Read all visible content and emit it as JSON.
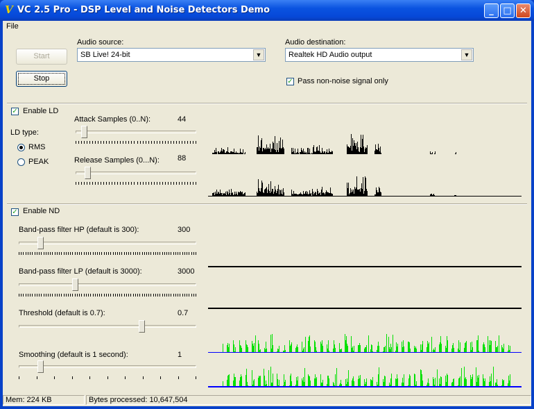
{
  "window": {
    "title": "VC 2.5 Pro - DSP Level and Noise Detectors Demo",
    "icon": "app-v-icon"
  },
  "menu": {
    "file": "File"
  },
  "buttons": {
    "start": "Start",
    "stop": "Stop"
  },
  "audio_source": {
    "label": "Audio source:",
    "value": "SB Live! 24-bit"
  },
  "audio_destination": {
    "label": "Audio destination:",
    "value": "Realtek HD Audio output"
  },
  "pass_non_noise": {
    "label": "Pass non-noise signal only",
    "checked": true
  },
  "ld": {
    "enable_label": "Enable LD",
    "enabled": true,
    "type_label": "LD type:",
    "rms_label": "RMS",
    "peak_label": "PEAK",
    "selected": "RMS",
    "attack": {
      "label": "Attack Samples (0..N):",
      "value": "44",
      "position": 0.05
    },
    "release": {
      "label": "Release Samples (0...N):",
      "value": "88",
      "position": 0.08
    },
    "graph_color": "#000000"
  },
  "nd": {
    "enable_label": "Enable ND",
    "enabled": true,
    "hp": {
      "label": "Band-pass filter HP (default is 300):",
      "value": "300",
      "position": 0.11
    },
    "lp": {
      "label": "Band-pass filter LP (default is 3000):",
      "value": "3000",
      "position": 0.31
    },
    "threshold": {
      "label": "Threshold (default is 0.7):",
      "value": "0.7",
      "position": 0.7
    },
    "smoothing": {
      "label": "Smoothing (default is 1 second):",
      "value": "1",
      "position": 0.11
    },
    "signal_color": "#00e000",
    "baseline_color": "#0000ff"
  },
  "status": {
    "mem": "Mem: 224 KB",
    "bytes_label": "Bytes processed:",
    "bytes": "10,647,504"
  }
}
